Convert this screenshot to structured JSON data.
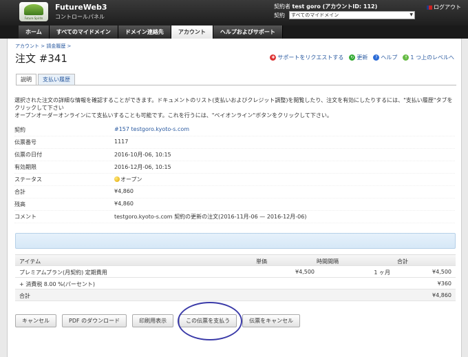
{
  "header": {
    "logo_text": "Future Spirits",
    "app_name": "FutureWeb3",
    "app_sub": "コントロールパネル",
    "account_prefix": "契約者",
    "account_name": "test goro (アカウントID: 112)",
    "contract_label": "契約",
    "contract_select": "すべてのマイドメイン",
    "logout": "ログアウト"
  },
  "nav": [
    "ホーム",
    "すべてのマイドメイン",
    "ドメイン連絡先",
    "アカウント",
    "ヘルプおよびサポート"
  ],
  "breadcrumb": "アカウント > 請金履歴 >",
  "page_title": "注文 #341",
  "actions": {
    "support": "サポートをリクエストする",
    "refresh": "更新",
    "help": "ヘルプ",
    "up": "1 つ上のレベルへ"
  },
  "tabs": [
    "説明",
    "支払い履歴"
  ],
  "description": {
    "line1": "選択された注文の詳細な情報を確認することができます。ドキュメントのリスト(支払いおよびクレジット調整)を閲覧したり、注文を有効にしたりするには、\"支払い履歴\"タブをクリックして下さい",
    "line2": "オープンオーダーオンラインにて支払いすることも可能です。これを行うには、\"ペイオンライン\"ボタンをクリックして下さい。"
  },
  "details": {
    "contract_label": "契約",
    "contract_value": "#157  testgoro.kyoto-s.com",
    "invoice_label": "伝票番号",
    "invoice_value": "1117",
    "date_label": "伝票の日付",
    "date_value": "2016-10月-06, 10:15",
    "expiry_label": "有効期限",
    "expiry_value": "2016-12月-06, 10:15",
    "status_label": "ステータス",
    "status_value": "オープン",
    "total_label": "合計",
    "total_value": "¥4,860",
    "balance_label": "残高",
    "balance_value": "¥4,860",
    "comment_label": "コメント",
    "comment_value": "testgoro.kyoto-s.com 契約の更新の注文(2016-11月-06 — 2016-12月-06)"
  },
  "items": {
    "headers": {
      "item": "アイテム",
      "unit": "単価",
      "time": "時間間隔",
      "total": "合計"
    },
    "row1": {
      "item": "プレミアムプラン(月契約) 定期費用",
      "unit": "¥4,500",
      "time": "1 ヶ月",
      "total": "¥4,500"
    },
    "tax": {
      "item": "+ 消費税 8.00 %(パーセント)",
      "total": "¥360"
    },
    "sum": {
      "item": "合計",
      "total": "¥4,860"
    }
  },
  "buttons": {
    "cancel": "キャンセル",
    "pdf": "PDF のダウンロード",
    "print": "印刷用表示",
    "pay": "この伝票を支払う",
    "cancel_invoice": "伝票をキャンセル"
  }
}
